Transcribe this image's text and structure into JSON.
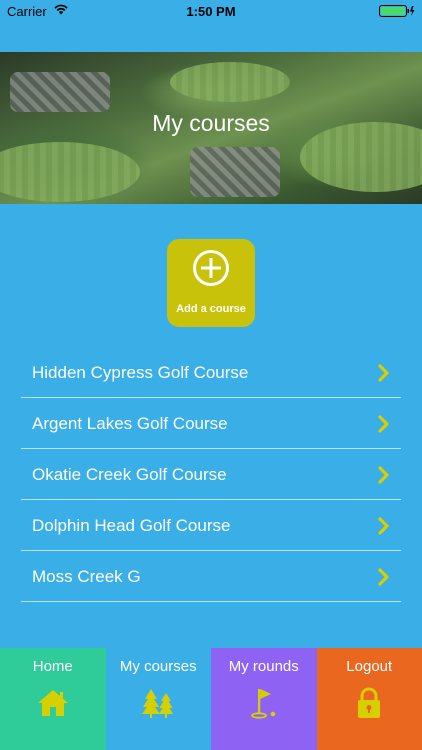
{
  "status": {
    "carrier": "Carrier",
    "time": "1:50 PM"
  },
  "header": {
    "title": "My courses"
  },
  "add_course": {
    "label": "Add a course"
  },
  "courses": [
    {
      "name": "Hidden Cypress Golf Course"
    },
    {
      "name": "Argent Lakes Golf Course"
    },
    {
      "name": "Okatie Creek Golf Course"
    },
    {
      "name": "Dolphin Head Golf Course"
    },
    {
      "name": "Moss Creek G"
    }
  ],
  "tabs": [
    {
      "label": "Home",
      "icon": "home-icon",
      "color": "#2fcb98"
    },
    {
      "label": "My courses",
      "icon": "trees-icon",
      "color": "#3aaee6"
    },
    {
      "label": "My rounds",
      "icon": "golf-flag-icon",
      "color": "#8e62f3"
    },
    {
      "label": "Logout",
      "icon": "lock-icon",
      "color": "#e9671f"
    }
  ],
  "colors": {
    "background": "#3aaee6",
    "accent": "#c9c20b",
    "icon_yellow": "#d7d000"
  }
}
